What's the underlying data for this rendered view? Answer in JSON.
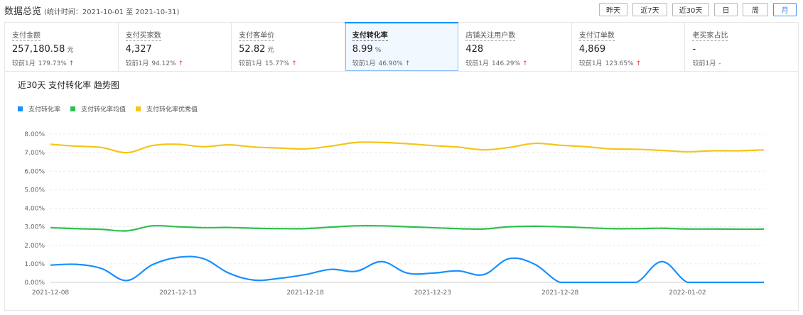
{
  "header": {
    "title": "数据总览",
    "stat_range": "(统计时间：2021-10-01 至 2021-10-31)",
    "periods": [
      "昨天",
      "近7天",
      "近30天",
      "日",
      "周",
      "月"
    ],
    "active_period": "月"
  },
  "metrics": [
    {
      "label": "支付金额",
      "value": "257,180.58",
      "unit": "元",
      "compare_label": "较前1月",
      "compare_value": "179.73%",
      "trend": "up"
    },
    {
      "label": "支付买家数",
      "value": "4,327",
      "unit": "",
      "compare_label": "较前1月",
      "compare_value": "94.12%",
      "trend": "up"
    },
    {
      "label": "支付客单价",
      "value": "52.82",
      "unit": "元",
      "compare_label": "较前1月",
      "compare_value": "15.77%",
      "trend": "up"
    },
    {
      "label": "支付转化率",
      "value": "8.99",
      "unit": "%",
      "compare_label": "较前1月",
      "compare_value": "46.90%",
      "trend": "up",
      "active": true
    },
    {
      "label": "店铺关注用户数",
      "value": "428",
      "unit": "",
      "compare_label": "较前1月",
      "compare_value": "146.29%",
      "trend": "up"
    },
    {
      "label": "支付订单数",
      "value": "4,869",
      "unit": "",
      "compare_label": "较前1月",
      "compare_value": "123.65%",
      "trend": "up"
    },
    {
      "label": "老买家占比",
      "value": "-",
      "unit": "",
      "compare_label": "较前1月",
      "compare_value": "-",
      "trend": "none"
    }
  ],
  "trend_arrow": "↑",
  "chart_title": "近30天 支付转化率 趋势图",
  "chart_data": {
    "type": "line",
    "x": [
      "2021-12-08",
      "2021-12-09",
      "2021-12-10",
      "2021-12-11",
      "2021-12-12",
      "2021-12-13",
      "2021-12-14",
      "2021-12-15",
      "2021-12-16",
      "2021-12-17",
      "2021-12-18",
      "2021-12-19",
      "2021-12-20",
      "2021-12-21",
      "2021-12-22",
      "2021-12-23",
      "2021-12-24",
      "2021-12-25",
      "2021-12-26",
      "2021-12-27",
      "2021-12-28",
      "2021-12-29",
      "2021-12-30",
      "2021-12-31",
      "2022-01-01",
      "2022-01-02",
      "2022-01-03",
      "2022-01-04",
      "2022-01-05"
    ],
    "x_ticks": [
      "2021-12-08",
      "2021-12-13",
      "2021-12-18",
      "2021-12-23",
      "2021-12-28",
      "2022-01-02"
    ],
    "y_ticks": [
      "0.00%",
      "1.00%",
      "2.00%",
      "3.00%",
      "4.00%",
      "5.00%",
      "6.00%",
      "7.00%",
      "8.00%"
    ],
    "ylim": [
      0,
      8
    ],
    "grid": true,
    "legend_position": "top-left",
    "series": [
      {
        "name": "支付转化率",
        "color": "#1890ff",
        "values": [
          0.93,
          0.97,
          0.75,
          0.1,
          0.95,
          1.35,
          1.28,
          0.5,
          0.12,
          0.22,
          0.42,
          0.7,
          0.6,
          1.12,
          0.5,
          0.5,
          0.62,
          0.42,
          1.28,
          0.98,
          0.0,
          0.0,
          0.0,
          0.0,
          1.12,
          0.0,
          0.0,
          0.0,
          0.0
        ]
      },
      {
        "name": "支付转化率均值",
        "color": "#2fbf4f",
        "values": [
          2.95,
          2.9,
          2.86,
          2.78,
          3.05,
          3.0,
          2.95,
          2.96,
          2.92,
          2.9,
          2.9,
          2.98,
          3.05,
          3.05,
          3.0,
          2.95,
          2.9,
          2.88,
          3.0,
          3.03,
          3.0,
          2.95,
          2.9,
          2.9,
          2.92,
          2.88,
          2.88,
          2.87,
          2.87
        ]
      },
      {
        "name": "支付转化率优秀值",
        "color": "#f5c518",
        "values": [
          7.45,
          7.35,
          7.28,
          7.0,
          7.38,
          7.45,
          7.32,
          7.42,
          7.3,
          7.25,
          7.2,
          7.35,
          7.55,
          7.55,
          7.48,
          7.38,
          7.3,
          7.15,
          7.28,
          7.5,
          7.4,
          7.32,
          7.2,
          7.18,
          7.12,
          7.05,
          7.1,
          7.1,
          7.15
        ]
      }
    ]
  }
}
